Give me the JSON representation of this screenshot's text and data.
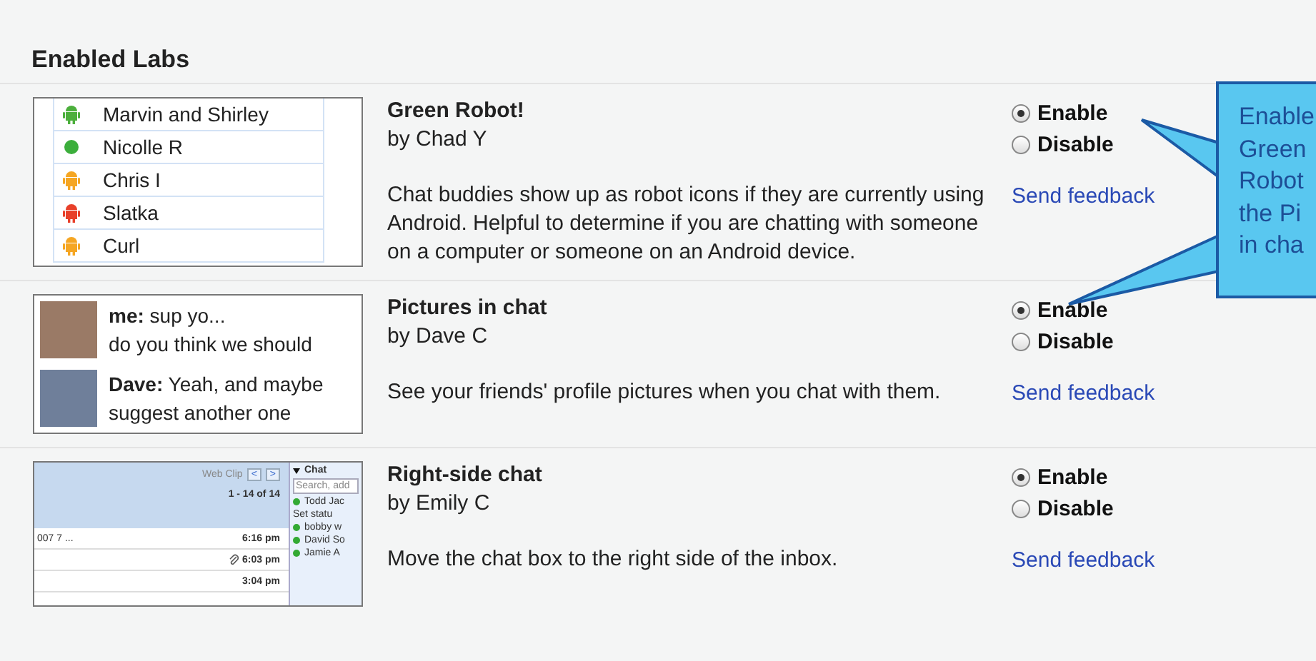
{
  "section_title": "Enabled Labs",
  "labs": [
    {
      "kind": "buddies",
      "title": "Green Robot!",
      "author": "by Chad Y",
      "description": "Chat buddies show up as robot icons if they are currently using Android. Helpful to determine if you are chatting with someone on a computer or someone on an Android device.",
      "options": [
        {
          "label": "Enable",
          "selected": true
        },
        {
          "label": "Disable",
          "selected": false
        }
      ],
      "feedback": "Send feedback",
      "preview": {
        "buddies": [
          {
            "name": "Marvin and Shirley",
            "kind": "android",
            "color": "#4caf3c"
          },
          {
            "name": "Nicolle R",
            "kind": "dot",
            "color": "#3cae3c"
          },
          {
            "name": "Chris I",
            "kind": "android",
            "color": "#f5a623"
          },
          {
            "name": "Slatka",
            "kind": "android",
            "color": "#e8402a"
          },
          {
            "name": "Curl",
            "kind": "android",
            "color": "#f5a623"
          }
        ]
      }
    },
    {
      "kind": "chat",
      "title": "Pictures in chat",
      "author": "by Dave C",
      "description": "See your friends' profile pictures when you chat with them.",
      "options": [
        {
          "label": "Enable",
          "selected": true
        },
        {
          "label": "Disable",
          "selected": false
        }
      ],
      "feedback": "Send feedback",
      "preview": {
        "messages": [
          {
            "sender": "me:",
            "lines": [
              "sup yo...",
              "do you think we should"
            ]
          },
          {
            "sender": "Dave:",
            "lines": [
              "Yeah, and maybe",
              "suggest another one"
            ]
          }
        ]
      }
    },
    {
      "kind": "inbox",
      "title": "Right-side chat",
      "author": "by Emily C",
      "description": "Move the chat box to the right side of the inbox.",
      "options": [
        {
          "label": "Enable",
          "selected": true
        },
        {
          "label": "Disable",
          "selected": false
        }
      ],
      "feedback": "Send feedback",
      "preview": {
        "web_clip": "Web Clip",
        "prev": "<",
        "next": ">",
        "count": "1 - 14 of 14",
        "rows": [
          {
            "snippet": "007 7 ...",
            "time": "6:16 pm",
            "attachment": false
          },
          {
            "snippet": "",
            "time": "6:03 pm",
            "attachment": true
          },
          {
            "snippet": "",
            "time": "3:04 pm",
            "attachment": false
          }
        ],
        "chat_title": "Chat",
        "chat_search": "Search, add",
        "me": "Todd Jac",
        "status": "Set statu",
        "contacts": [
          "bobby w",
          "David So",
          "Jamie A"
        ]
      }
    }
  ],
  "callout": {
    "lines": [
      "Enable",
      "Green",
      "Robot",
      "the Pi",
      "in cha"
    ]
  }
}
